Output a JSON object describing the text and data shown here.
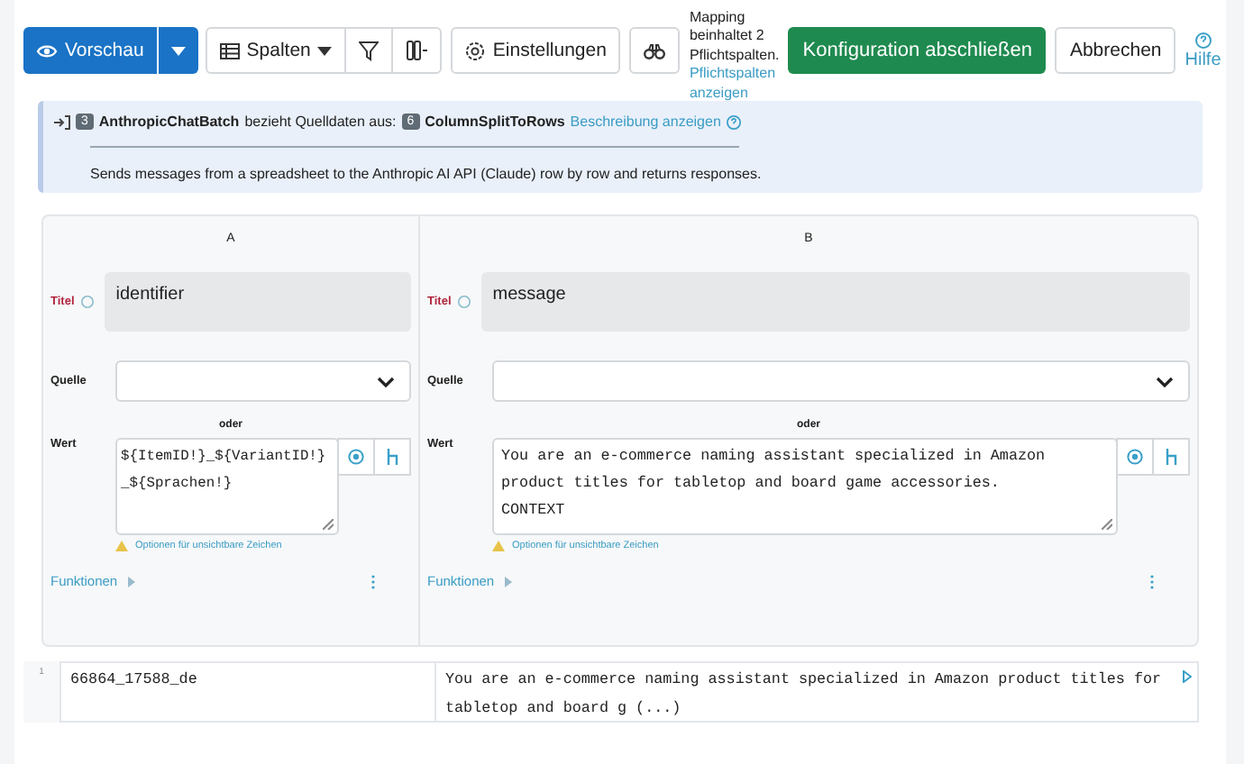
{
  "toolbar": {
    "preview_button": "Vorschau",
    "columns_button": "Spalten",
    "settings_button": "Einstellungen",
    "notice": "Mapping beinhaltet 2 Pflichtspalten.",
    "notice_link": "Pflichtspalten anzeigen",
    "finish_button": "Konfiguration abschließen",
    "cancel_button": "Abbrechen",
    "help_link": "Hilfe"
  },
  "info": {
    "source_badge": "3",
    "source_name": "AnthropicChatBatch",
    "middle_text": "bezieht Quelldaten aus:",
    "target_badge": "6",
    "target_name": "ColumnSplitToRows",
    "description_link": "Beschreibung anzeigen",
    "description": "Sends messages from a spreadsheet to the Anthropic AI API (Claude) row by row and returns responses."
  },
  "mapping": {
    "columns": [
      {
        "letter": "A",
        "title_label": "Titel",
        "title": "identifier",
        "source_label": "Quelle",
        "or": "oder",
        "value_label": "Wert",
        "value": "${ItemID!}_${VariantID!}_${Sprachen!}",
        "hint": "Optionen für unsichtbare Zeichen",
        "functions": "Funktionen"
      },
      {
        "letter": "B",
        "title_label": "Titel",
        "title": "message",
        "source_label": "Quelle",
        "or": "oder",
        "value_label": "Wert",
        "value": "You are an e-commerce naming assistant specialized in Amazon\nproduct titles for tabletop and board game accessories.\nCONTEXT",
        "hint": "Optionen für unsichtbare Zeichen",
        "functions": "Funktionen"
      }
    ]
  },
  "preview": {
    "rows": [
      {
        "number": "1",
        "cells": [
          "66864_17588_de",
          "You are an e-commerce naming assistant specialized in Amazon product titles for tabletop and board g (...)"
        ]
      }
    ]
  }
}
